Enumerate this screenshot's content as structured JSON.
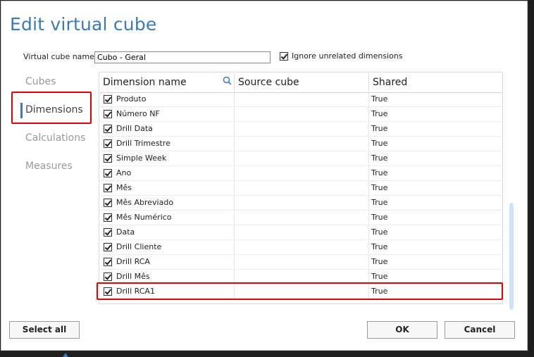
{
  "dialog": {
    "title": "Edit virtual cube",
    "virtual_cube_name_label": "Virtual cube name",
    "virtual_cube_name_value": "Cubo - Geral",
    "ignore_unrelated_label": "Ignore unrelated dimensions",
    "ignore_unrelated_checked": true
  },
  "nav": {
    "items": [
      {
        "label": "Cubes",
        "active": false
      },
      {
        "label": "Dimensions",
        "active": true
      },
      {
        "label": "Calculations",
        "active": false
      },
      {
        "label": "Measures",
        "active": false
      }
    ]
  },
  "grid": {
    "columns": [
      "Dimension name",
      "Source cube",
      "Shared"
    ],
    "rows": [
      {
        "name": "Produto",
        "source": "",
        "shared": "True",
        "checked": true
      },
      {
        "name": "Número NF",
        "source": "",
        "shared": "True",
        "checked": true
      },
      {
        "name": "Drill Data",
        "source": "",
        "shared": "True",
        "checked": true
      },
      {
        "name": "Drill Trimestre",
        "source": "",
        "shared": "True",
        "checked": true
      },
      {
        "name": "Simple Week",
        "source": "",
        "shared": "True",
        "checked": true
      },
      {
        "name": "Ano",
        "source": "",
        "shared": "True",
        "checked": true
      },
      {
        "name": "Mês",
        "source": "",
        "shared": "True",
        "checked": true
      },
      {
        "name": "Mês Abreviado",
        "source": "",
        "shared": "True",
        "checked": true
      },
      {
        "name": "Mês Numérico",
        "source": "",
        "shared": "True",
        "checked": true
      },
      {
        "name": "Data",
        "source": "",
        "shared": "True",
        "checked": true
      },
      {
        "name": "Drill Cliente",
        "source": "",
        "shared": "True",
        "checked": true
      },
      {
        "name": "Drill RCA",
        "source": "",
        "shared": "True",
        "checked": true
      },
      {
        "name": "Drill Mês",
        "source": "",
        "shared": "True",
        "checked": true
      },
      {
        "name": "Drill RCA1",
        "source": "",
        "shared": "True",
        "checked": true
      }
    ]
  },
  "buttons": {
    "select_all": "Select all",
    "ok": "OK",
    "cancel": "Cancel"
  },
  "colors": {
    "accent": "#3a7ab8",
    "highlight_box": "#e00000"
  }
}
